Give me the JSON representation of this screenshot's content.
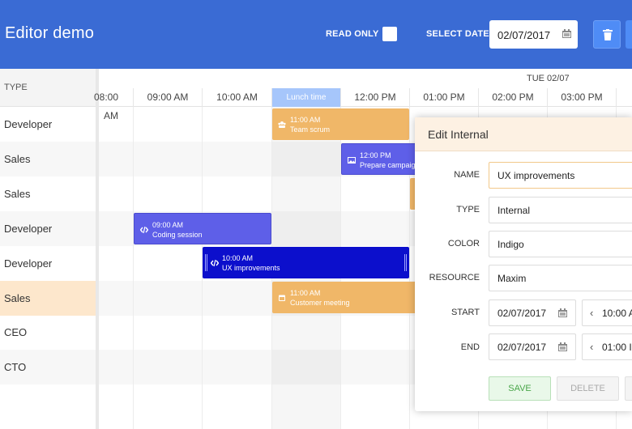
{
  "header": {
    "title": "Editor demo",
    "read_only_label": "READ ONLY",
    "select_date_label": "SELECT DATE",
    "date_value": "02/07/2017"
  },
  "resources": {
    "column_header": "TYPE",
    "rows": [
      "Developer",
      "Sales",
      "Sales",
      "Developer",
      "Developer",
      "Sales",
      "CEO",
      "CTO"
    ]
  },
  "timeline": {
    "day_label": "TUE 02/07",
    "hours": [
      "08:00 AM",
      "09:00 AM",
      "10:00 AM",
      "Lunch time",
      "12:00 PM",
      "01:00 PM",
      "02:00 PM",
      "03:00 PM"
    ]
  },
  "events": [
    {
      "time": "11:00 AM",
      "title": "Team scrum",
      "icon": "team-icon",
      "color": "#f0b768"
    },
    {
      "time": "12:00 PM",
      "title": "Prepare campaign",
      "icon": "image-icon",
      "color": "#5e5fe8"
    },
    {
      "time": "09:00 AM",
      "title": "Coding session",
      "icon": "code-icon",
      "color": "#5e5fe8"
    },
    {
      "time": "10:00 AM",
      "title": "UX improvements",
      "icon": "code-icon",
      "color": "#0c0fcc"
    },
    {
      "time": "11:00 AM",
      "title": "Customer meeting",
      "icon": "calendar-icon",
      "color": "#f0b768"
    }
  ],
  "popup": {
    "title": "Edit Internal",
    "name_label": "NAME",
    "name_value": "UX improvements",
    "type_label": "TYPE",
    "type_value": "Internal",
    "color_label": "COLOR",
    "color_value": "Indigo",
    "resource_label": "RESOURCE",
    "resource_value": "Maxim",
    "start_label": "START",
    "start_date": "02/07/2017",
    "start_time": "10:00 A",
    "end_label": "END",
    "end_date": "02/07/2017",
    "end_time": "01:00 I",
    "save_label": "SAVE",
    "delete_label": "DELETE"
  },
  "colors": {
    "header": "#3a6bd4",
    "accent_button": "#4f8cf6",
    "lunch": "#a6c6fb",
    "highlight_row": "#fde7cc",
    "popup_header": "#fdf1e3"
  }
}
